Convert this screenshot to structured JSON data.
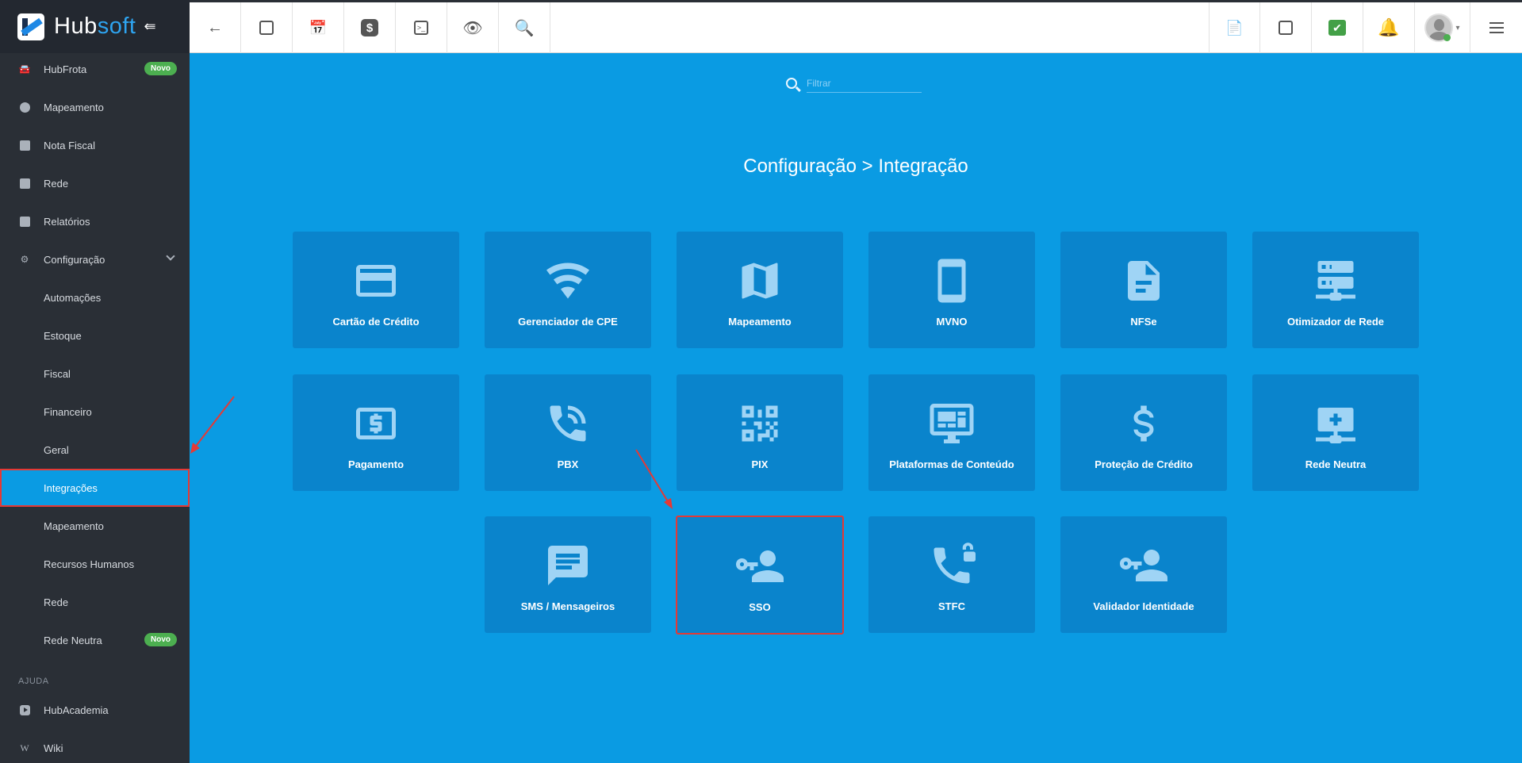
{
  "app": {
    "brand_hub": "Hub",
    "brand_soft": "soft"
  },
  "sidebar": {
    "items": [
      {
        "label": "HubFrota",
        "badge": "Novo"
      },
      {
        "label": "Mapeamento"
      },
      {
        "label": "Nota Fiscal"
      },
      {
        "label": "Rede"
      },
      {
        "label": "Relatórios"
      },
      {
        "label": "Configuração"
      }
    ],
    "subitems": [
      {
        "label": "Automações"
      },
      {
        "label": "Estoque"
      },
      {
        "label": "Fiscal"
      },
      {
        "label": "Financeiro"
      },
      {
        "label": "Geral"
      },
      {
        "label": "Integrações",
        "active": true
      },
      {
        "label": "Mapeamento"
      },
      {
        "label": "Recursos Humanos"
      },
      {
        "label": "Rede"
      },
      {
        "label": "Rede Neutra",
        "badge": "Novo"
      }
    ],
    "help_section": "AJUDA",
    "help_items": [
      {
        "label": "HubAcademia"
      },
      {
        "label": "Wiki"
      }
    ]
  },
  "search": {
    "placeholder": "Filtrar"
  },
  "page": {
    "title": "Configuração > Integração"
  },
  "tiles": [
    {
      "label": "Cartão de Crédito",
      "icon": "credit-card-icon"
    },
    {
      "label": "Gerenciador de CPE",
      "icon": "wifi-icon"
    },
    {
      "label": "Mapeamento",
      "icon": "map-icon"
    },
    {
      "label": "MVNO",
      "icon": "phone-icon"
    },
    {
      "label": "NFSe",
      "icon": "document-icon"
    },
    {
      "label": "Otimizador de Rede",
      "icon": "server-network-icon"
    },
    {
      "label": "Pagamento",
      "icon": "cash-icon"
    },
    {
      "label": "PBX",
      "icon": "phone-call-icon"
    },
    {
      "label": "PIX",
      "icon": "qrcode-icon"
    },
    {
      "label": "Plataformas de Conteúdo",
      "icon": "monitor-dashboard-icon"
    },
    {
      "label": "Proteção de Crédito",
      "icon": "dollar-icon"
    },
    {
      "label": "Rede Neutra",
      "icon": "server-plus-icon"
    },
    {
      "label": "SMS / Mensageiros",
      "icon": "message-icon"
    },
    {
      "label": "SSO",
      "icon": "account-key-icon"
    },
    {
      "label": "STFC",
      "icon": "phone-lock-icon"
    },
    {
      "label": "Validador Identidade",
      "icon": "account-key-icon"
    }
  ],
  "colors": {
    "accent": "#0a9be3",
    "tile": "#0a84cc",
    "sidebar": "#2a2f36",
    "highlight": "#e53935"
  }
}
